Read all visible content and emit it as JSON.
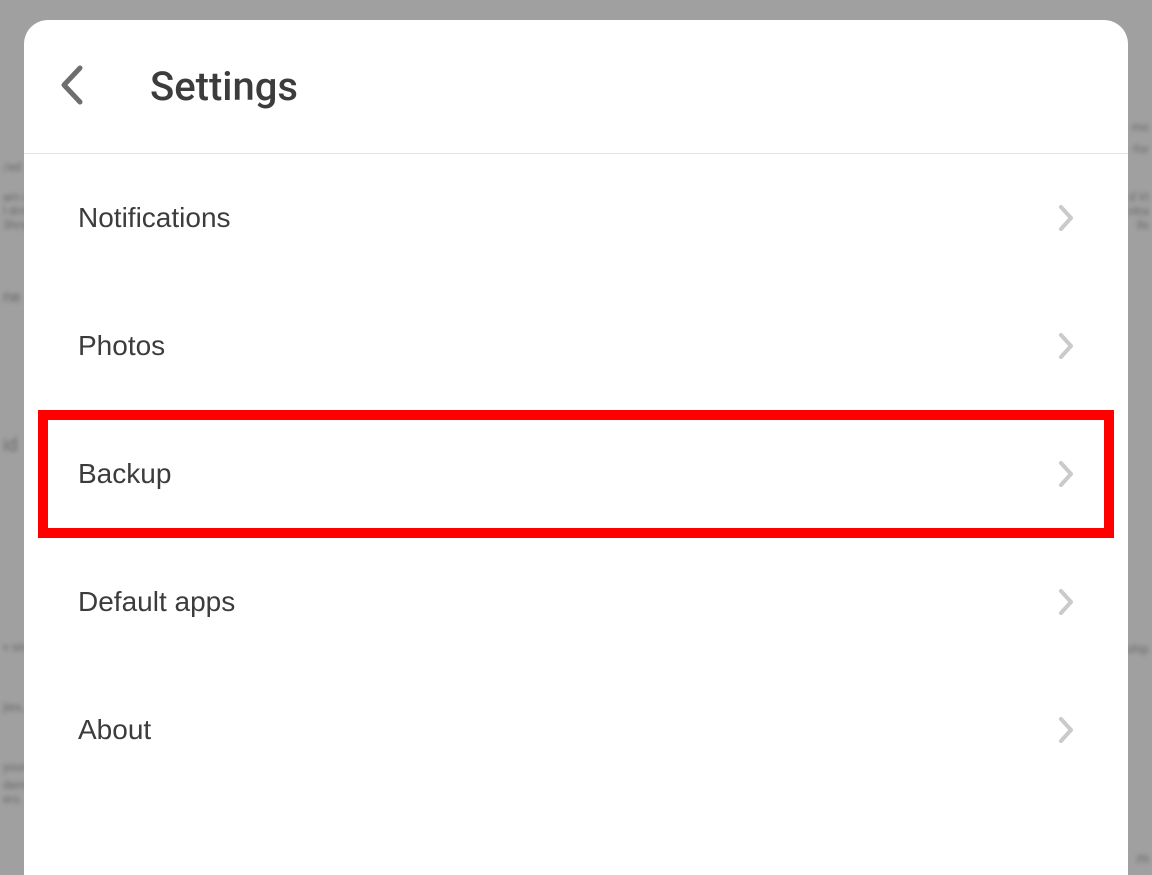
{
  "header": {
    "title": "Settings"
  },
  "items": [
    {
      "label": "Notifications",
      "highlighted": false
    },
    {
      "label": "Photos",
      "highlighted": false
    },
    {
      "label": "Backup",
      "highlighted": true
    },
    {
      "label": "Default apps",
      "highlighted": false
    },
    {
      "label": "About",
      "highlighted": false
    }
  ],
  "annotation": {
    "highlight_color": "#ff0000"
  },
  "bg": {
    "f1": "/ed",
    "f2": "am c",
    "f3": "l driv",
    "f4": "3hrs)",
    "f5": "ne",
    "f6": "id",
    "f7": "v sim",
    "f8": "jies,",
    "f9": "your",
    "f10": "demi",
    "f11": "ers.",
    "r1": "mo",
    "r2": "-for",
    "r3": "d Vi",
    "r4": "ntra",
    "r5": "lls",
    "r6": "ship",
    "r7": "m"
  }
}
